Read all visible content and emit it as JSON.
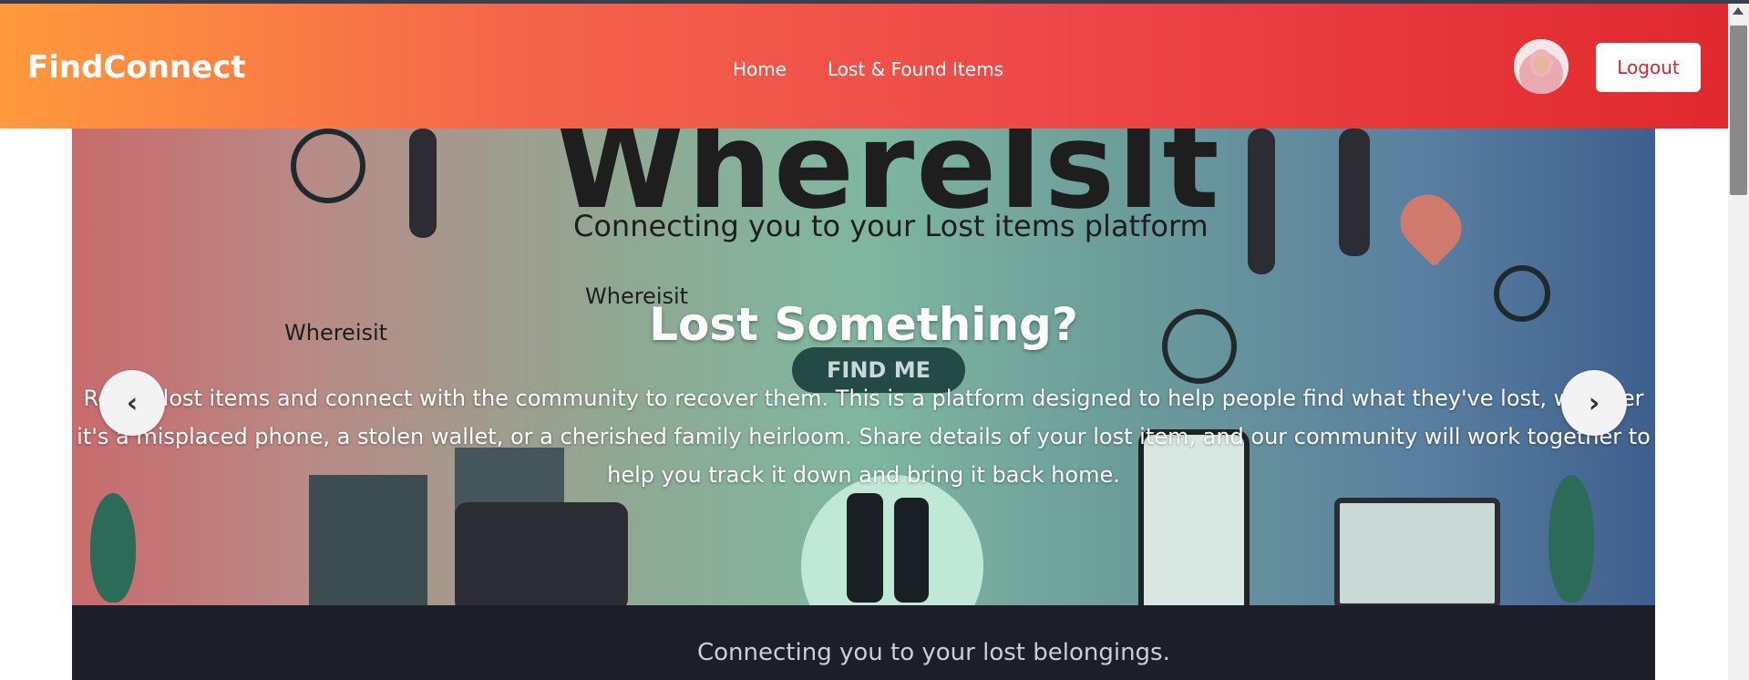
{
  "navbar": {
    "brand": "FindConnect",
    "links": [
      {
        "label": "Home"
      },
      {
        "label": "Lost & Found Items"
      }
    ],
    "logout_label": "Logout",
    "colors": {
      "gradient_start": "#ff9a3d",
      "gradient_end": "#e0292e"
    }
  },
  "hero": {
    "image_text": {
      "title": "WhereIsIt",
      "subtitle": "Connecting you to your Lost items platform",
      "small_logo_a": "Whereisit",
      "small_logo_b": "Whereisit",
      "find_me": "FIND ME",
      "bottom": "Connecting you to your lost belongings."
    },
    "title": "Lost Something?",
    "description": "Report lost items and connect with the community to recover them. This is a platform designed to help people find what they've lost, whether it's a misplaced phone, a stolen wallet, or a cherished family heirloom. Share details of your lost item, and our community will work together to help you track it down and bring it back home.",
    "prev_icon": "‹",
    "next_icon": "›"
  }
}
